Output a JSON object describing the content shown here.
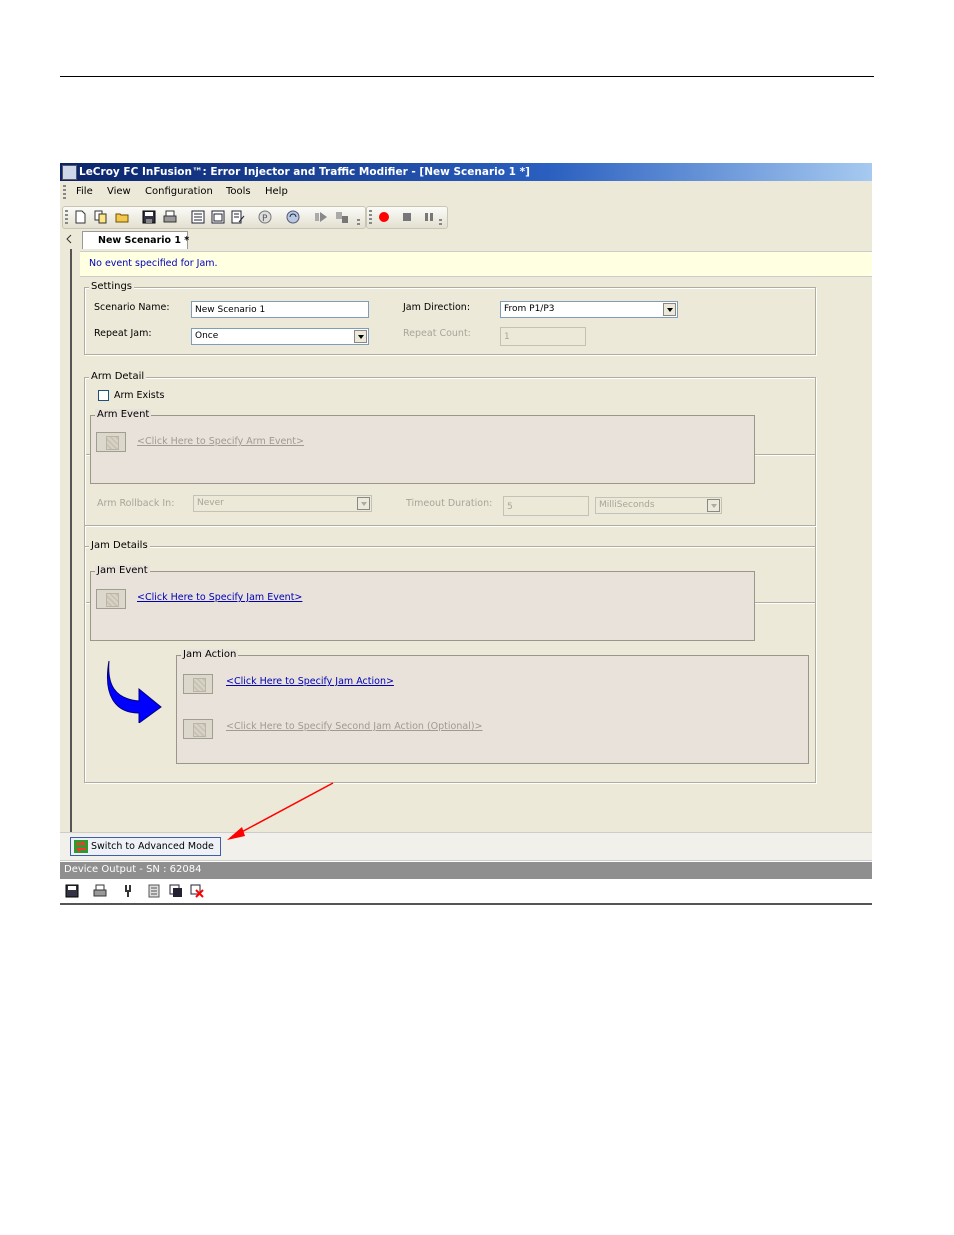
{
  "window": {
    "title": "LeCroy FC InFusion™: Error Injector and Traffic Modifier - [New Scenario 1 *]"
  },
  "menu": {
    "items": [
      {
        "label": "File"
      },
      {
        "label": "View"
      },
      {
        "label": "Configuration"
      },
      {
        "label": "Tools"
      },
      {
        "label": "Help"
      }
    ]
  },
  "toolbar": {
    "icons": [
      "new-icon",
      "open-copy-icon",
      "open-folder-icon",
      "save-icon",
      "print-icon",
      "list-view-icon",
      "window-icon",
      "edit-icon",
      "p-icon",
      "refresh-icon",
      "play-icon",
      "step-icon",
      "record-icon",
      "stop-icon",
      "pause-icon"
    ],
    "colors": {
      "record": "#ff0000"
    }
  },
  "tabs": [
    {
      "label": "New Scenario 1 *"
    }
  ],
  "info": {
    "message": "No event specified for Jam."
  },
  "settings": {
    "group_label": "Settings",
    "scenario_name_label": "Scenario Name:",
    "scenario_name_value": "New Scenario 1",
    "repeat_jam_label": "Repeat Jam:",
    "repeat_jam_value": "Once",
    "jam_direction_label": "Jam Direction:",
    "jam_direction_value": "From P1/P3",
    "repeat_count_label": "Repeat Count:",
    "repeat_count_value": "1"
  },
  "arm_detail": {
    "group_label": "Arm Detail",
    "arm_exists_label": "Arm Exists",
    "arm_event_label": "Arm Event",
    "arm_event_link": "<Click Here to Specify Arm Event>",
    "arm_rollback_label": "Arm Rollback In:",
    "arm_rollback_value": "Never",
    "timeout_label": "Timeout Duration:",
    "timeout_value": "5",
    "timeout_unit": "MilliSeconds"
  },
  "jam_details": {
    "group_label": "Jam Details",
    "jam_event_label": "Jam Event",
    "jam_event_link": "<Click Here to Specify Jam Event>",
    "jam_action_label": "Jam Action",
    "jam_action_link": "<Click Here to Specify Jam Action>",
    "second_action_link": "<Click Here to Specify Second Jam Action (Optional)>",
    "arrow_color": "#0000ff"
  },
  "footer": {
    "advanced_button": "Switch to Advanced Mode",
    "device_output": "Device Output - SN : 62084",
    "annotation_arrow_color": "#ff0000"
  }
}
